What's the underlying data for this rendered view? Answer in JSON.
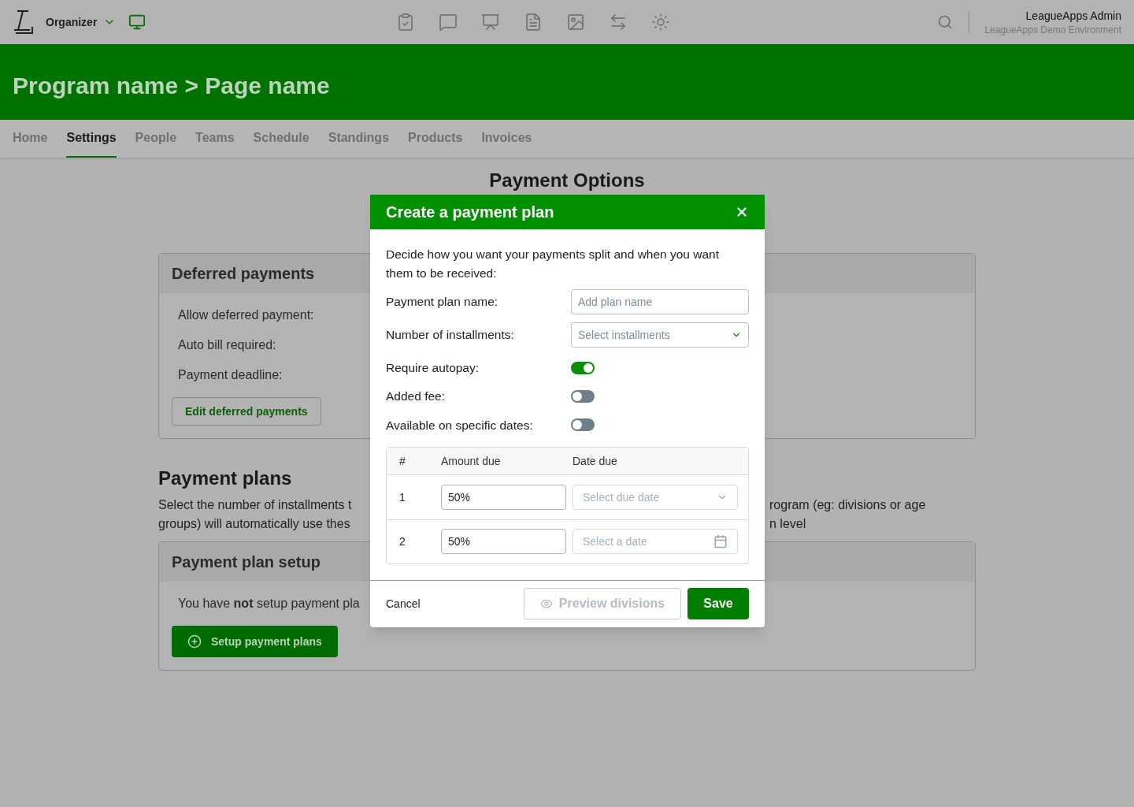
{
  "topbar": {
    "role": "Organizer",
    "user": "LeagueApps Admin",
    "environment": "LeagueApps Demo Environment"
  },
  "header": {
    "title": "Program name > Page name"
  },
  "tabs": [
    {
      "label": "Home",
      "selected": false
    },
    {
      "label": "Settings",
      "selected": true
    },
    {
      "label": "People",
      "selected": false
    },
    {
      "label": "Teams",
      "selected": false
    },
    {
      "label": "Schedule",
      "selected": false
    },
    {
      "label": "Standings",
      "selected": false
    },
    {
      "label": "Products",
      "selected": false
    },
    {
      "label": "Invoices",
      "selected": false
    }
  ],
  "page_title": "Payment Options",
  "deferred_card": {
    "title": "Deferred payments",
    "fields": [
      "Allow deferred payment:",
      "Auto bill required:",
      "Payment deadline:"
    ],
    "button": "Edit deferred payments"
  },
  "payment_plans": {
    "title": "Payment plans",
    "description_left": [
      "Select the number of installments t",
      "groups) will automatically use thes"
    ],
    "description_right": [
      "rogram (eg: divisions or age",
      "n level"
    ]
  },
  "setup_card": {
    "title": "Payment plan setup",
    "message": "You have **not** setup payment pla",
    "button": "Setup payment plans"
  },
  "modal": {
    "title": "Create a payment plan",
    "intro": "Decide how you want your payments split and when you want them to be received:",
    "name_field": {
      "label": "Payment plan name:",
      "placeholder": "Add plan name"
    },
    "installments_field": {
      "label": "Number of installments:",
      "placeholder": "Select installments"
    },
    "toggles": [
      {
        "label": "Require autopay:",
        "on": true
      },
      {
        "label": "Added fee:",
        "on": false
      },
      {
        "label": "Available on specific dates:",
        "on": false
      }
    ],
    "table": {
      "columns": [
        "#",
        "Amount due",
        "Date due"
      ],
      "rows": [
        {
          "number": "1",
          "amount": "50%",
          "date_placeholder": "Select due date",
          "kind": "select"
        },
        {
          "number": "2",
          "amount": "50%",
          "date_placeholder": "Select a date",
          "kind": "date"
        }
      ]
    },
    "cancel": "Cancel",
    "preview": "Preview divisions",
    "save": "Save"
  }
}
